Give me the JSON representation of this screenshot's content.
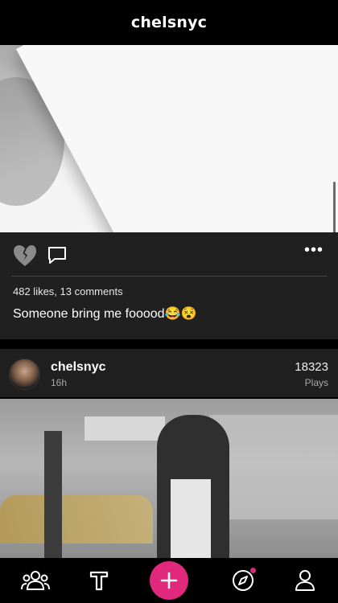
{
  "header": {
    "title": "chelsnyc"
  },
  "post1": {
    "stats": "482 likes, 13 comments",
    "caption": "Someone bring me fooood😂😵",
    "more_label": "•••"
  },
  "post2": {
    "username": "chelsnyc",
    "time": "16h",
    "plays_count": "18323",
    "plays_label": "Plays"
  },
  "tabbar": {
    "items": [
      "community-icon",
      "text-post-icon",
      "plus-icon",
      "explore-icon",
      "profile-icon"
    ]
  },
  "colors": {
    "accent": "#e0287c",
    "card_bg": "#202020",
    "background": "#000000"
  }
}
